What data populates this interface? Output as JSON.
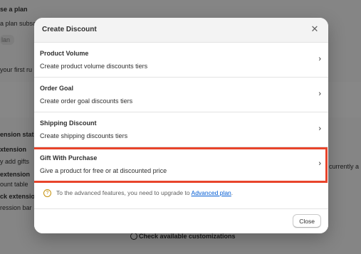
{
  "background": {
    "plan_heading": "se a plan",
    "plan_sub": "a plan subsc",
    "plan_button": "lan",
    "first_rule": "your first ru",
    "ext_status": "ension stat",
    "extension1": "xtension",
    "extension1_sub": "y add gifts",
    "extension2": "extension",
    "extension2_sub": "ount table",
    "extension3": "ck extensio",
    "extension3_sub": "ression bar",
    "right_text": "currently a",
    "bottom_link": "Check available customizations"
  },
  "modal": {
    "title": "Create Discount",
    "close_icon": "close-icon",
    "options": [
      {
        "title": "Product Volume",
        "desc": "Create product volume discounts tiers"
      },
      {
        "title": "Order Goal",
        "desc": "Create order goal discounts tiers"
      },
      {
        "title": "Shipping Discount",
        "desc": "Create shipping discounts tiers"
      },
      {
        "title": "Gift With Purchase",
        "desc": "Give a product for free or at discounted price"
      }
    ],
    "notice_text": "To the advanced features, you need to upgrade to",
    "notice_link": "Advanced plan",
    "notice_end": ".",
    "close_button": "Close"
  },
  "colors": {
    "highlight": "#e8442b",
    "link": "#005bd3",
    "warning": "#c5900b"
  }
}
